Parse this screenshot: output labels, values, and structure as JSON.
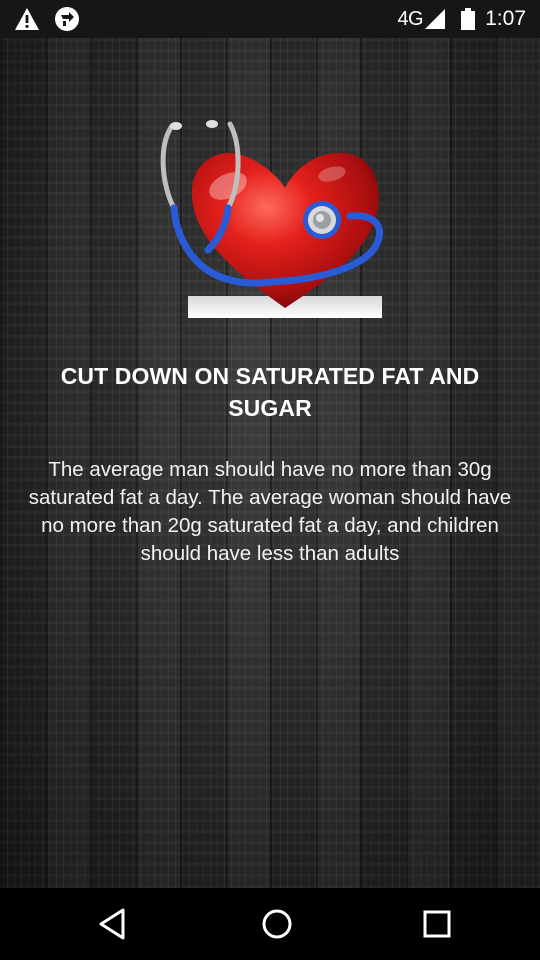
{
  "status_bar": {
    "network": "4G",
    "time": "1:07",
    "left_icons": [
      "warning-icon",
      "sync-notification-icon"
    ],
    "right_icons": [
      "signal-icon",
      "battery-icon"
    ]
  },
  "main": {
    "image_icon": "heart-stethoscope-image",
    "title": "CUT DOWN ON SATURATED FAT AND SUGAR",
    "body": "The average man should have no more than 30g saturated fat a day. The average woman should have no more than 20g saturated fat a day, and children should have less than adults"
  },
  "nav_bar": {
    "buttons": [
      "back-icon",
      "home-icon",
      "recents-icon"
    ]
  },
  "colors": {
    "heart_red": "#d81818",
    "stethoscope_blue": "#2a5bd7",
    "text": "#ffffff"
  }
}
